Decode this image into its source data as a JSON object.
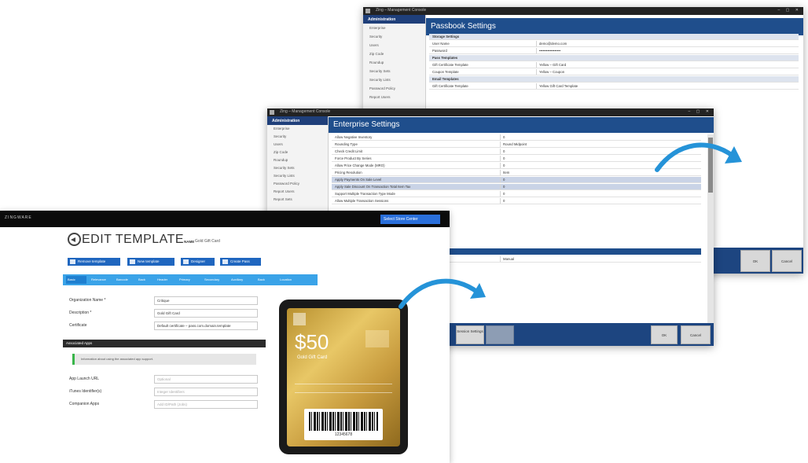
{
  "passbook": {
    "title": "Passbook Settings",
    "window_title": "Zing – Management Console",
    "side_head": "Administration",
    "side_items": [
      "Enterprise",
      "Security",
      "Users",
      "Zip Code",
      "Roundup",
      "Security Sets",
      "Security Lists",
      "Password Policy",
      "Report Users"
    ],
    "rows": [
      {
        "label": "Storage Settings",
        "value": "",
        "group": true
      },
      {
        "label": "User Name",
        "value": "demo@demo.com",
        "group": false
      },
      {
        "label": "Password",
        "value": "••••••••••••••••••",
        "group": false
      },
      {
        "label": "Pass Templates",
        "value": "",
        "group": true
      },
      {
        "label": "Gift Certificate Template",
        "value": "Yellow – Gift Card",
        "group": false
      },
      {
        "label": "Coupon Template",
        "value": "Yellow – Coupon",
        "group": false
      },
      {
        "label": "Email Templates",
        "value": "",
        "group": true
      },
      {
        "label": "Gift Certificate Template",
        "value": "Yellow Gift Card Template",
        "group": false
      }
    ]
  },
  "enterprise": {
    "title": "Enterprise Settings",
    "window_title": "Zing – Management Console",
    "side_head": "Administration",
    "side_items": [
      "Enterprise",
      "Security",
      "Users",
      "Zip Code",
      "Roundup",
      "Security Sets",
      "Security Lists",
      "Password Policy",
      "Report Users",
      "Report Sets"
    ],
    "rows": [
      {
        "label": "Allow Negative Inventory",
        "value": "0",
        "sel": false
      },
      {
        "label": "Rounding Type",
        "value": "Round Midpoint",
        "sel": false
      },
      {
        "label": "Check Credit Limit",
        "value": "0",
        "sel": false
      },
      {
        "label": "Force Product By Series",
        "value": "0",
        "sel": false
      },
      {
        "label": "Allow Price Change Mode (MRO)",
        "value": "0",
        "sel": false
      },
      {
        "label": "Pricing Resolution",
        "value": "Item",
        "sel": false
      },
      {
        "label": "Apply Payments On Sale Level",
        "value": "0",
        "sel": true
      },
      {
        "label": "Apply Sale Discount On Transaction Total Item Tax",
        "value": "0",
        "sel": true
      },
      {
        "label": "Support Multiple Transaction Type Mode",
        "value": "0",
        "sel": false
      },
      {
        "label": "Allow Multiple Transaction Sessions",
        "value": "0",
        "sel": false
      }
    ],
    "buttons": {
      "session": "Session Settings",
      "ok": "OK",
      "cancel": "Cancel"
    },
    "manual_value": "Manual"
  },
  "template": {
    "logo": "ZINGWARE",
    "nav_button": "Select Store Center",
    "title": "EDIT TEMPLATE",
    "name_label": "NAME",
    "name_value": "Gold Gift Card",
    "actions": [
      "Remove template",
      "New template",
      "Designer",
      "Create Pass"
    ],
    "tabs": [
      "Basic",
      "Relevance",
      "Barcode",
      "Back",
      "Header",
      "Primary",
      "Secondary",
      "Auxiliary",
      "Back",
      "Location"
    ],
    "fields": [
      {
        "label": "Organization Name *",
        "value": "Critique",
        "placeholder": false
      },
      {
        "label": "Description *",
        "value": "Gold Gift Card",
        "placeholder": false
      },
      {
        "label": "Certificate",
        "value": "Default certificate – pass.com.domain.template",
        "placeholder": false
      }
    ],
    "section": "Associated Apps",
    "info": "Information about using the associated app support.",
    "app_fields": [
      {
        "label": "App Launch URL",
        "value": "Optional",
        "placeholder": true
      },
      {
        "label": "iTunes Identifier(s)",
        "value": "Integer Identifiers",
        "placeholder": true
      },
      {
        "label": "Companion Apps",
        "value": "Add ID/Path (Jobs)",
        "placeholder": true
      }
    ]
  },
  "pass": {
    "amount": "$50",
    "name": "Gold Gift Card",
    "barcode_caption": "12345678"
  },
  "colors": {
    "header": "#1f4e8c",
    "accent": "#2a6fdb",
    "tab": "#3aa3e8",
    "arrow": "#2593d8",
    "gold": "#c9a24a"
  }
}
